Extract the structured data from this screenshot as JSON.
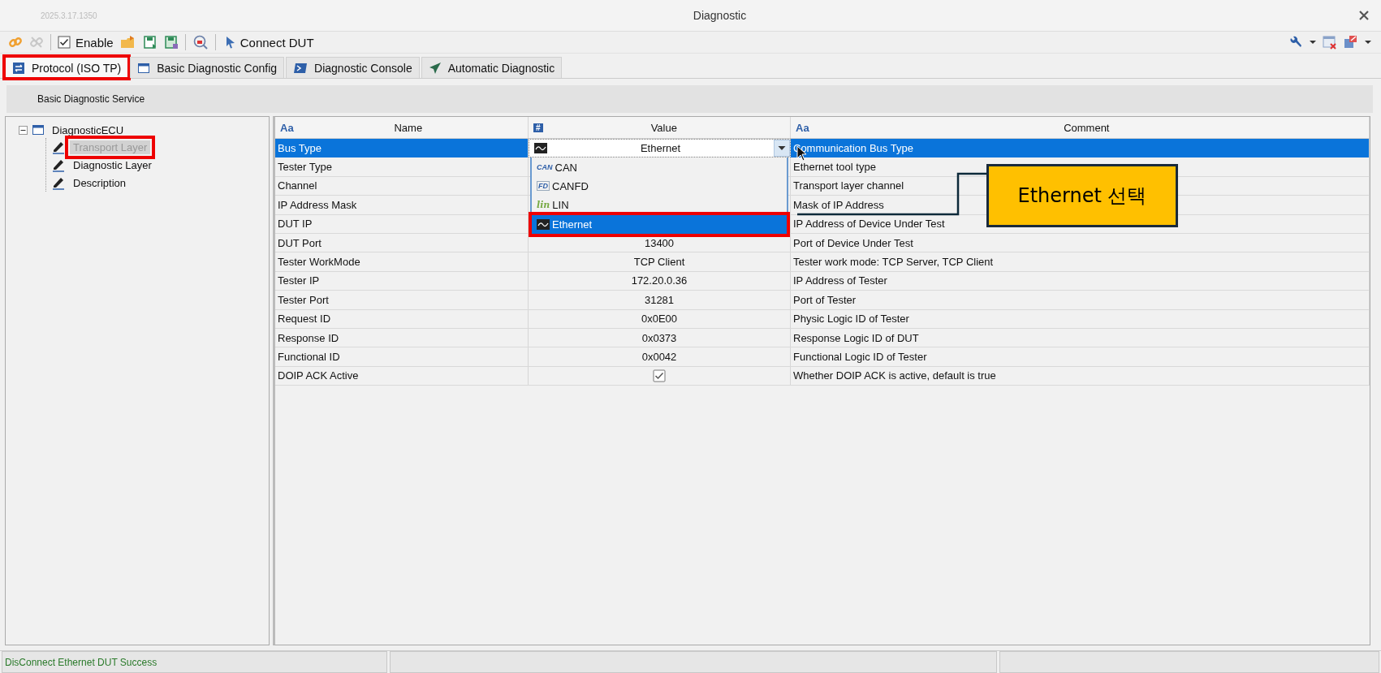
{
  "window": {
    "version": "2025.3.17.1350",
    "title": "Diagnostic"
  },
  "toolbar": {
    "enable": {
      "label": "Enable",
      "checked": true
    },
    "connect": "Connect DUT"
  },
  "tabs": [
    {
      "label": "Protocol (ISO TP)",
      "selected": true,
      "highlight": true
    },
    {
      "label": "Basic Diagnostic Config",
      "selected": false,
      "highlight": false
    },
    {
      "label": "Diagnostic Console",
      "selected": false,
      "highlight": false
    },
    {
      "label": "Automatic Diagnostic",
      "selected": false,
      "highlight": false
    }
  ],
  "section": "Basic Diagnostic Service",
  "tree": {
    "label": "DiagnosticECU",
    "expanded": true,
    "children": [
      {
        "label": "Transport Layer",
        "selected": true,
        "highlight": true
      },
      {
        "label": "Diagnostic Layer",
        "selected": false,
        "highlight": false
      },
      {
        "label": "Description",
        "selected": false,
        "highlight": false
      }
    ]
  },
  "table": {
    "columns": [
      {
        "label": "Name",
        "kind": "text",
        "badge": "Aa"
      },
      {
        "label": "Value",
        "kind": "number",
        "badge": "#"
      },
      {
        "label": "Comment",
        "kind": "text",
        "badge": "Aa"
      }
    ],
    "rows": [
      {
        "kind": "combo",
        "name": "Bus Type",
        "value": "Ethernet",
        "comment": "Communication Bus Type",
        "selected": true
      },
      {
        "kind": "text",
        "name": "Tester Type",
        "comment": "Ethernet tool type",
        "selected": false
      },
      {
        "kind": "text",
        "name": "Channel",
        "comment": "Transport layer channel",
        "selected": false
      },
      {
        "kind": "text",
        "name": "IP Address Mask",
        "comment": "Mask of IP Address",
        "selected": false
      },
      {
        "kind": "text",
        "name": "DUT IP",
        "comment": "IP Address of Device Under Test",
        "selected": false
      },
      {
        "kind": "text",
        "name": "DUT Port",
        "value": "13400",
        "comment": "Port of Device Under Test",
        "selected": false
      },
      {
        "kind": "text",
        "name": "Tester WorkMode",
        "value": "TCP Client",
        "comment": "Tester work mode: TCP Server, TCP Client",
        "selected": false
      },
      {
        "kind": "text",
        "name": "Tester IP",
        "value": "172.20.0.36",
        "comment": "IP Address of Tester",
        "selected": false
      },
      {
        "kind": "text",
        "name": "Tester Port",
        "value": "31281",
        "comment": "Port of Tester",
        "selected": false
      },
      {
        "kind": "text",
        "name": "Request ID",
        "value": "0x0E00",
        "comment": "Physic Logic ID of Tester",
        "selected": false
      },
      {
        "kind": "text",
        "name": "Response ID",
        "value": "0x0373",
        "comment": "Response Logic ID of DUT",
        "selected": false
      },
      {
        "kind": "text",
        "name": "Functional ID",
        "value": "0x0042",
        "comment": "Functional Logic ID of Tester",
        "selected": false
      },
      {
        "kind": "check",
        "name": "DOIP ACK Active",
        "checked": true,
        "comment": "Whether DOIP ACK is active, default is true",
        "selected": false
      }
    ]
  },
  "dropdown": {
    "options": [
      {
        "label": "CAN",
        "badge": "CAN",
        "selected": false,
        "highlight": false
      },
      {
        "label": "CANFD",
        "badge": "FD",
        "selected": false,
        "highlight": false
      },
      {
        "label": "LIN",
        "badge": "lin",
        "selected": false,
        "highlight": false
      },
      {
        "label": "Ethernet",
        "selected": true,
        "highlight": true
      }
    ]
  },
  "callout": {
    "text": "Ethernet 선택"
  },
  "status_bar": {
    "message": "DisConnect Ethernet DUT Success"
  }
}
